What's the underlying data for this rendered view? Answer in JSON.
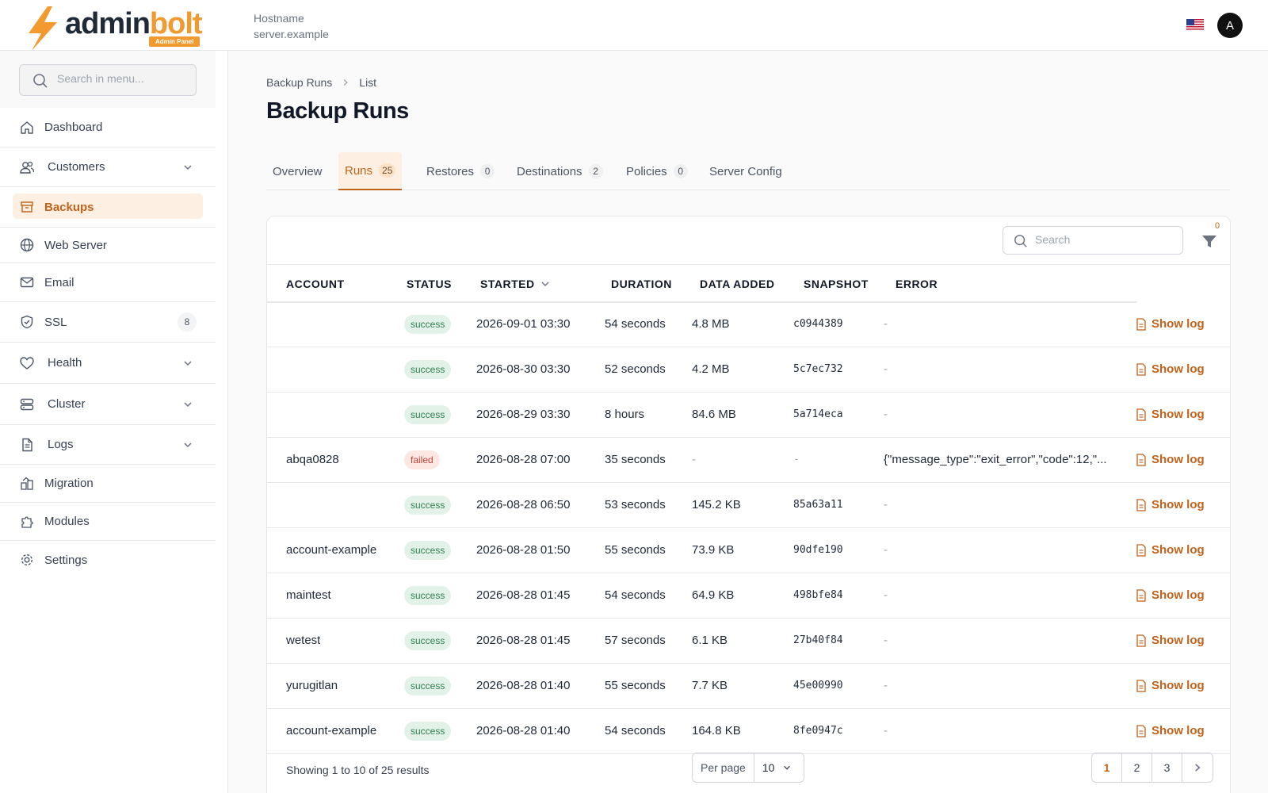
{
  "brand": {
    "name_part1": "admin",
    "name_part2": "bolt",
    "tagline": "Admin Panel",
    "accent": "#f29a2e"
  },
  "header": {
    "hostname_label": "Hostname",
    "hostname_value": "server.example",
    "avatar_initial": "A",
    "flag": "us-flag-icon"
  },
  "sidebar": {
    "search_placeholder": "Search in menu...",
    "items": [
      {
        "label": "Dashboard",
        "icon": "home-icon"
      },
      {
        "label": "Customers",
        "icon": "users-icon",
        "expandable": true
      },
      {
        "label": "Backups",
        "icon": "archive-icon",
        "active": true
      },
      {
        "label": "Web Server",
        "icon": "globe-icon"
      },
      {
        "label": "Email",
        "icon": "mail-icon"
      },
      {
        "label": "SSL",
        "icon": "shield-icon",
        "badge": "8"
      },
      {
        "label": "Health",
        "icon": "heart-icon",
        "expandable": true
      },
      {
        "label": "Cluster",
        "icon": "server-icon",
        "expandable": true
      },
      {
        "label": "Logs",
        "icon": "file-icon",
        "expandable": true
      },
      {
        "label": "Migration",
        "icon": "migration-icon"
      },
      {
        "label": "Modules",
        "icon": "puzzle-icon"
      },
      {
        "label": "Settings",
        "icon": "gear-icon"
      }
    ]
  },
  "breadcrumb": {
    "parent": "Backup Runs",
    "current": "List"
  },
  "page_title": "Backup Runs",
  "tabs": [
    {
      "label": "Overview",
      "count": ""
    },
    {
      "label": "Runs",
      "count": "25",
      "active": true
    },
    {
      "label": "Restores",
      "count": "0"
    },
    {
      "label": "Destinations",
      "count": "2"
    },
    {
      "label": "Policies",
      "count": "0"
    },
    {
      "label": "Server Config",
      "count": ""
    }
  ],
  "table": {
    "search_placeholder": "Search",
    "filter_count": "0",
    "columns": [
      "ACCOUNT",
      "STATUS",
      "STARTED",
      "DURATION",
      "DATA ADDED",
      "SNAPSHOT",
      "ERROR"
    ],
    "action_label": "Show log",
    "rows": [
      {
        "account": "",
        "status": "success",
        "started": "2026-09-01 03:30",
        "duration": "54 seconds",
        "data_added": "4.8 MB",
        "snapshot": "c0944389",
        "error": "-"
      },
      {
        "account": "",
        "status": "success",
        "started": "2026-08-30 03:30",
        "duration": "52 seconds",
        "data_added": "4.2 MB",
        "snapshot": "5c7ec732",
        "error": "-"
      },
      {
        "account": "",
        "status": "success",
        "started": "2026-08-29 03:30",
        "duration": "8 hours",
        "data_added": "84.6 MB",
        "snapshot": "5a714eca",
        "error": "-"
      },
      {
        "account": "abqa0828",
        "status": "failed",
        "started": "2026-08-28 07:00",
        "duration": "35 seconds",
        "data_added": "-",
        "snapshot": "-",
        "error": "{\"message_type\":\"exit_error\",\"code\":12,\"..."
      },
      {
        "account": "",
        "status": "success",
        "started": "2026-08-28 06:50",
        "duration": "53 seconds",
        "data_added": "145.2 KB",
        "snapshot": "85a63a11",
        "error": "-"
      },
      {
        "account": "account-example",
        "status": "success",
        "started": "2026-08-28 01:50",
        "duration": "55 seconds",
        "data_added": "73.9 KB",
        "snapshot": "90dfe190",
        "error": "-"
      },
      {
        "account": "maintest",
        "status": "success",
        "started": "2026-08-28 01:45",
        "duration": "54 seconds",
        "data_added": "64.9 KB",
        "snapshot": "498bfe84",
        "error": "-"
      },
      {
        "account": "wetest",
        "status": "success",
        "started": "2026-08-28 01:45",
        "duration": "57 seconds",
        "data_added": "6.1 KB",
        "snapshot": "27b40f84",
        "error": "-"
      },
      {
        "account": "yurugitlan",
        "status": "success",
        "started": "2026-08-28 01:40",
        "duration": "55 seconds",
        "data_added": "7.7 KB",
        "snapshot": "45e00990",
        "error": "-"
      },
      {
        "account": "account-example",
        "status": "success",
        "started": "2026-08-28 01:40",
        "duration": "54 seconds",
        "data_added": "164.8 KB",
        "snapshot": "8fe0947c",
        "error": "-"
      }
    ]
  },
  "footer": {
    "summary": "Showing 1 to 10 of 25 results",
    "per_page_label": "Per page",
    "per_page_value": "10",
    "pages": [
      "1",
      "2",
      "3"
    ],
    "current_page": "1"
  }
}
